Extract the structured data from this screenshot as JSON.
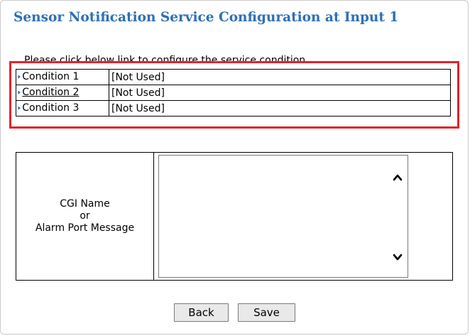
{
  "page": {
    "title": "Sensor Notification Service Configuration at Input 1",
    "instruction": "Please click below link to configure the service condition"
  },
  "conditions": [
    {
      "label": "Condition 1",
      "status": "[Not Used]"
    },
    {
      "label": "Condition 2",
      "status": "[Not Used]"
    },
    {
      "label": "Condition 3",
      "status": "[Not Used]"
    }
  ],
  "message_section": {
    "label_line1": "CGI Name",
    "label_line2": "or",
    "label_line3": "Alarm Port Message",
    "textarea_value": ""
  },
  "buttons": {
    "back": "Back",
    "save": "Save"
  },
  "colors": {
    "title": "#2f6fb5",
    "highlight_border": "#e3242b",
    "arrow": "#2f6fb5"
  },
  "icons": {
    "condition_arrow": "double-chevron-right-icon",
    "scroll_up": "chevron-up-icon",
    "scroll_down": "chevron-down-icon"
  }
}
